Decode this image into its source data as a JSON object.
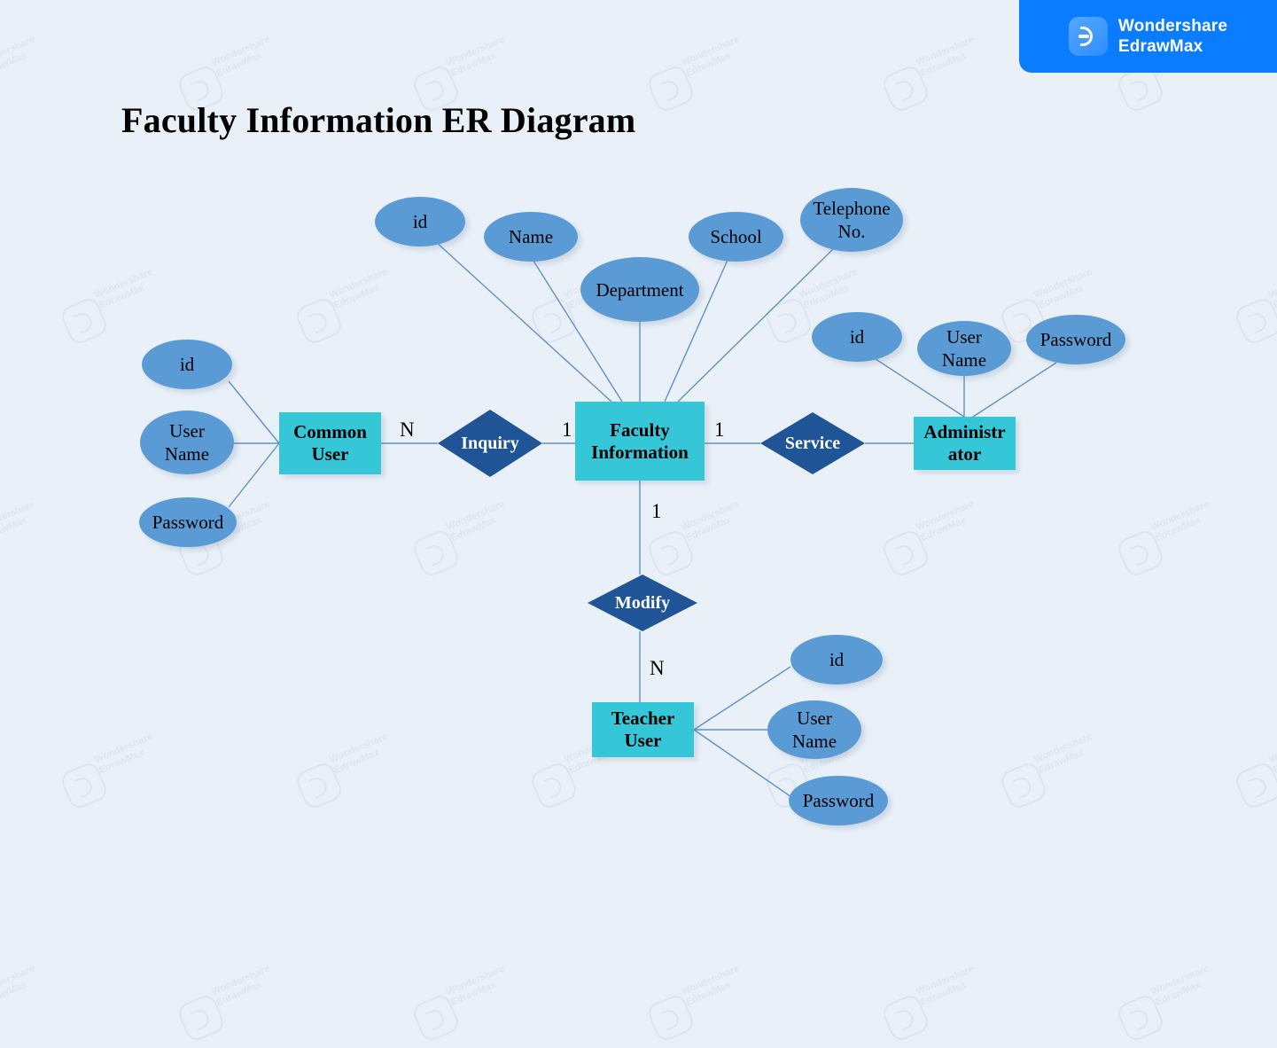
{
  "page": {
    "title": "Faculty Information ER Diagram",
    "background_color": "#e9f0f8"
  },
  "brand": {
    "name": "Wondershare\nEdrawMax",
    "logo_icon": "edrawmax-logo-icon",
    "banner_color": "#0a7cff"
  },
  "watermark": {
    "text": "Wondershare\nEdrawMax",
    "logo_icon": "edrawmax-watermark-icon"
  },
  "palette": {
    "entity_fill": "#35c6d8",
    "attribute_fill": "#5b9bd5",
    "relationship_fill": "#1f5496",
    "connector": "#5e92c4"
  },
  "diagram": {
    "entities": [
      {
        "id": "common_user",
        "label": "Common\nUser"
      },
      {
        "id": "faculty_information",
        "label": "Faculty\nInformation"
      },
      {
        "id": "administrator",
        "label": "Administr\nator"
      },
      {
        "id": "teacher_user",
        "label": "Teacher\nUser"
      }
    ],
    "relationships": [
      {
        "id": "inquiry",
        "label": "Inquiry"
      },
      {
        "id": "service",
        "label": "Service"
      },
      {
        "id": "modify",
        "label": "Modify"
      }
    ],
    "attributes": [
      {
        "id": "cu_id",
        "label": "id",
        "owner": "common_user"
      },
      {
        "id": "cu_username",
        "label": "User\nName",
        "owner": "common_user"
      },
      {
        "id": "cu_password",
        "label": "Password",
        "owner": "common_user"
      },
      {
        "id": "fi_id",
        "label": "id",
        "owner": "faculty_information"
      },
      {
        "id": "fi_name",
        "label": "Name",
        "owner": "faculty_information"
      },
      {
        "id": "fi_department",
        "label": "Department",
        "owner": "faculty_information"
      },
      {
        "id": "fi_school",
        "label": "School",
        "owner": "faculty_information"
      },
      {
        "id": "fi_telephone",
        "label": "Telephone\nNo.",
        "owner": "faculty_information"
      },
      {
        "id": "ad_id",
        "label": "id",
        "owner": "administrator"
      },
      {
        "id": "ad_username",
        "label": "User\nName",
        "owner": "administrator"
      },
      {
        "id": "ad_password",
        "label": "Password",
        "owner": "administrator"
      },
      {
        "id": "tu_id",
        "label": "id",
        "owner": "teacher_user"
      },
      {
        "id": "tu_username",
        "label": "User\nName",
        "owner": "teacher_user"
      },
      {
        "id": "tu_password",
        "label": "Password",
        "owner": "teacher_user"
      }
    ],
    "cardinalities": [
      {
        "id": "card_cu_inquiry",
        "label": "N"
      },
      {
        "id": "card_inquiry_fi",
        "label": "1"
      },
      {
        "id": "card_fi_service",
        "label": "1"
      },
      {
        "id": "card_fi_modify",
        "label": "1"
      },
      {
        "id": "card_modify_tu",
        "label": "N"
      }
    ]
  }
}
